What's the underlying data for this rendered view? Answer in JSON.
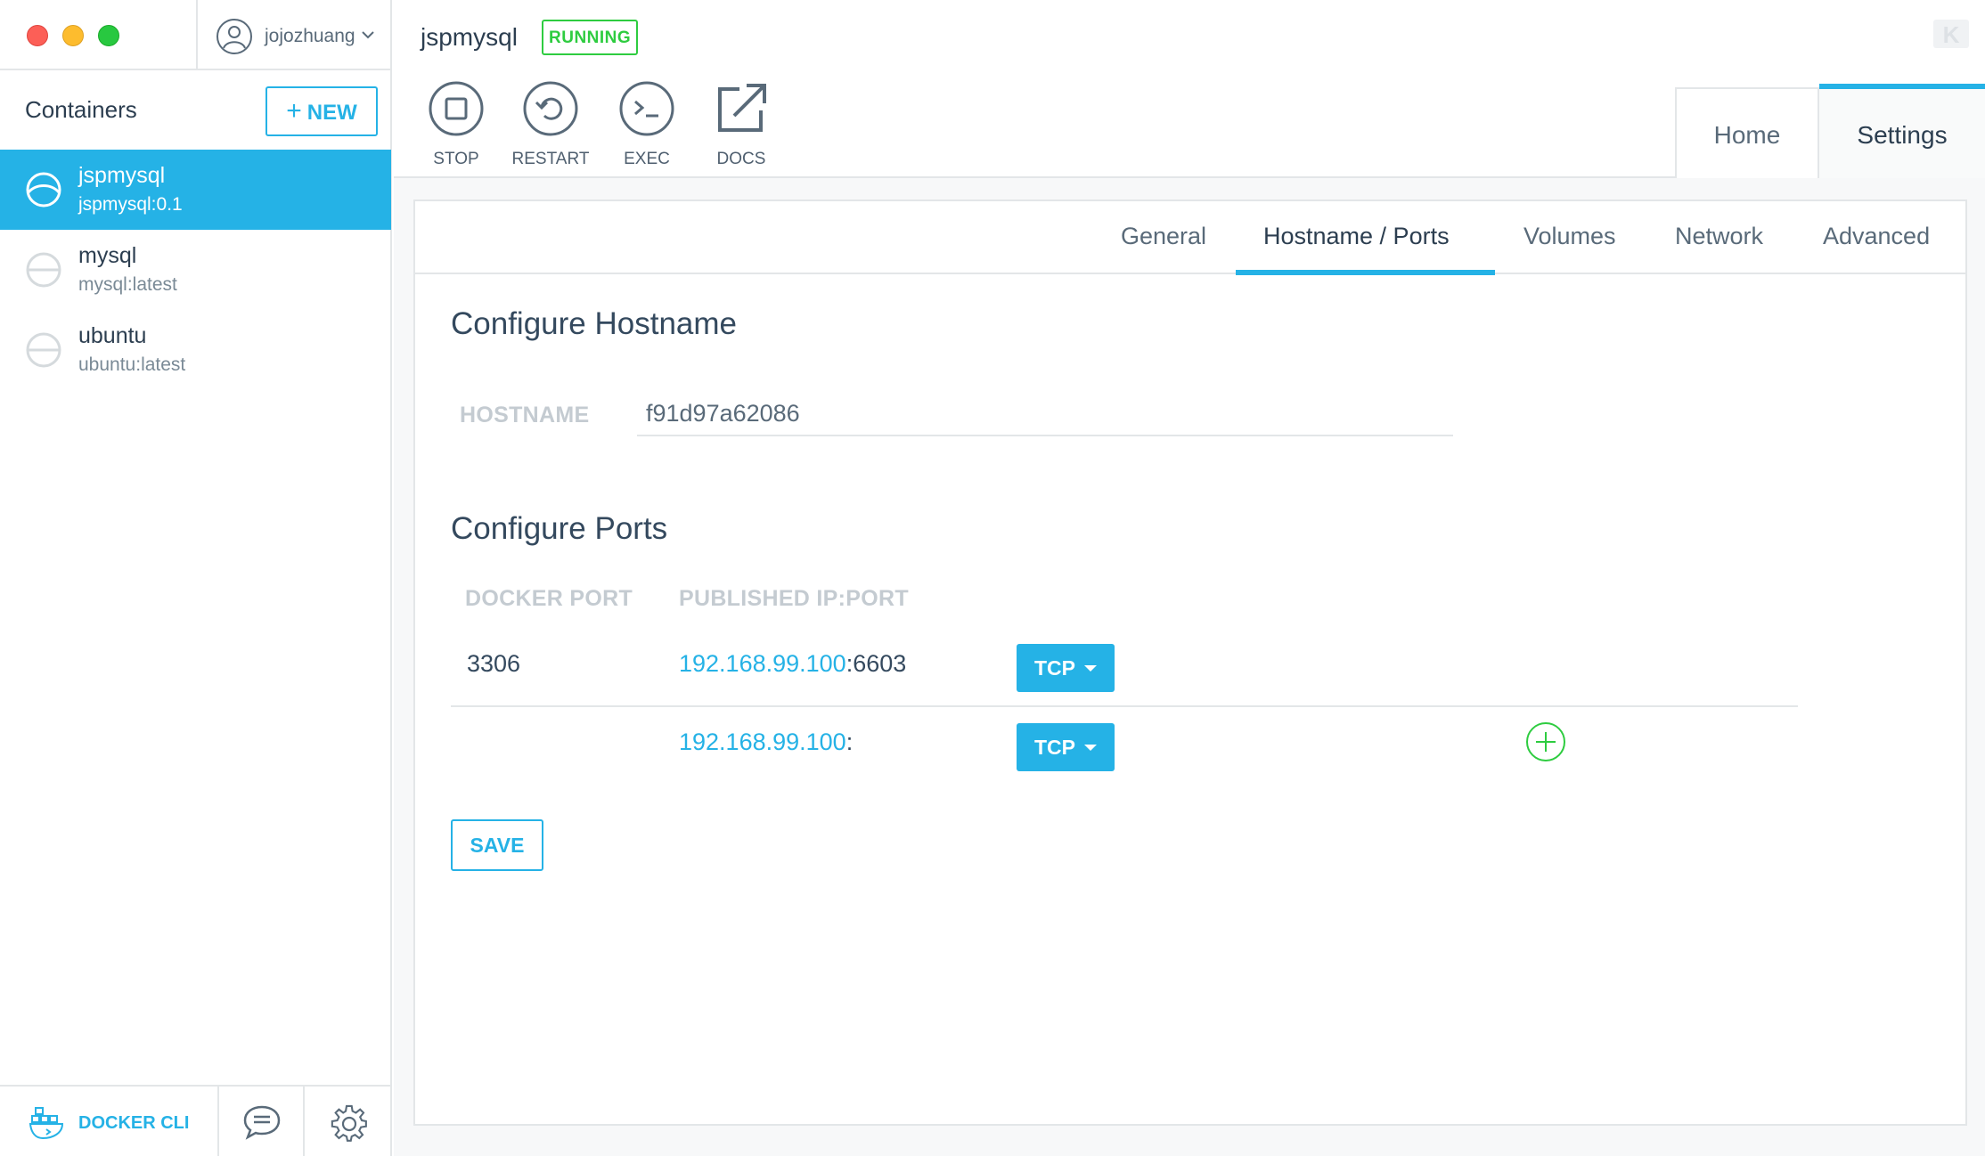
{
  "window": {
    "traffic_lights": {
      "close": "#fc5f57",
      "minimize": "#fdbc2e",
      "zoom": "#28c840"
    }
  },
  "user": {
    "name": "jojozhuang"
  },
  "sidebar": {
    "title": "Containers",
    "new_button": {
      "icon": "plus-icon",
      "label": "NEW"
    },
    "containers": [
      {
        "name": "jspmysql",
        "image": "jspmysql:0.1",
        "selected": true,
        "status_icon": "running-status-icon"
      },
      {
        "name": "mysql",
        "image": "mysql:latest",
        "selected": false,
        "status_icon": "stopped-status-icon"
      },
      {
        "name": "ubuntu",
        "image": "ubuntu:latest",
        "selected": false,
        "status_icon": "stopped-status-icon"
      }
    ],
    "footer": {
      "docker_cli": {
        "icon": "docker-whale-icon",
        "label": "DOCKER CLI"
      },
      "feedback_icon": "chat-bubble-icon",
      "settings_icon": "gear-icon"
    }
  },
  "header": {
    "container_name": "jspmysql",
    "status": "RUNNING",
    "logo": "kitematic-logo",
    "actions": [
      {
        "label": "STOP",
        "icon": "stop-icon"
      },
      {
        "label": "RESTART",
        "icon": "restart-icon"
      },
      {
        "label": "EXEC",
        "icon": "terminal-icon"
      },
      {
        "label": "DOCS",
        "icon": "external-link-icon"
      }
    ],
    "tabs": [
      {
        "label": "Home",
        "active": false
      },
      {
        "label": "Settings",
        "active": true
      }
    ]
  },
  "settings": {
    "subtabs": [
      {
        "label": "General",
        "active": false
      },
      {
        "label": "Hostname / Ports",
        "active": true
      },
      {
        "label": "Volumes",
        "active": false
      },
      {
        "label": "Network",
        "active": false
      },
      {
        "label": "Advanced",
        "active": false
      }
    ],
    "hostname": {
      "title": "Configure Hostname",
      "label": "HOSTNAME",
      "value": "f91d97a62086"
    },
    "ports": {
      "title": "Configure Ports",
      "col_docker_port": "DOCKER PORT",
      "col_published": "PUBLISHED IP:PORT",
      "rows": [
        {
          "docker_port": "3306",
          "ip": "192.168.99.100",
          "separator": ":",
          "port": "6603",
          "protocol": "TCP"
        },
        {
          "docker_port": "",
          "ip": "192.168.99.100",
          "separator": ":",
          "port": "",
          "protocol": "TCP"
        }
      ],
      "add_icon": "add-circle-icon"
    },
    "save_label": "SAVE"
  },
  "colors": {
    "accent": "#25b2e6",
    "running": "#2ecc40",
    "text": "#2c3e50",
    "muted": "#c4cbd1",
    "border": "#e3e6e8"
  }
}
